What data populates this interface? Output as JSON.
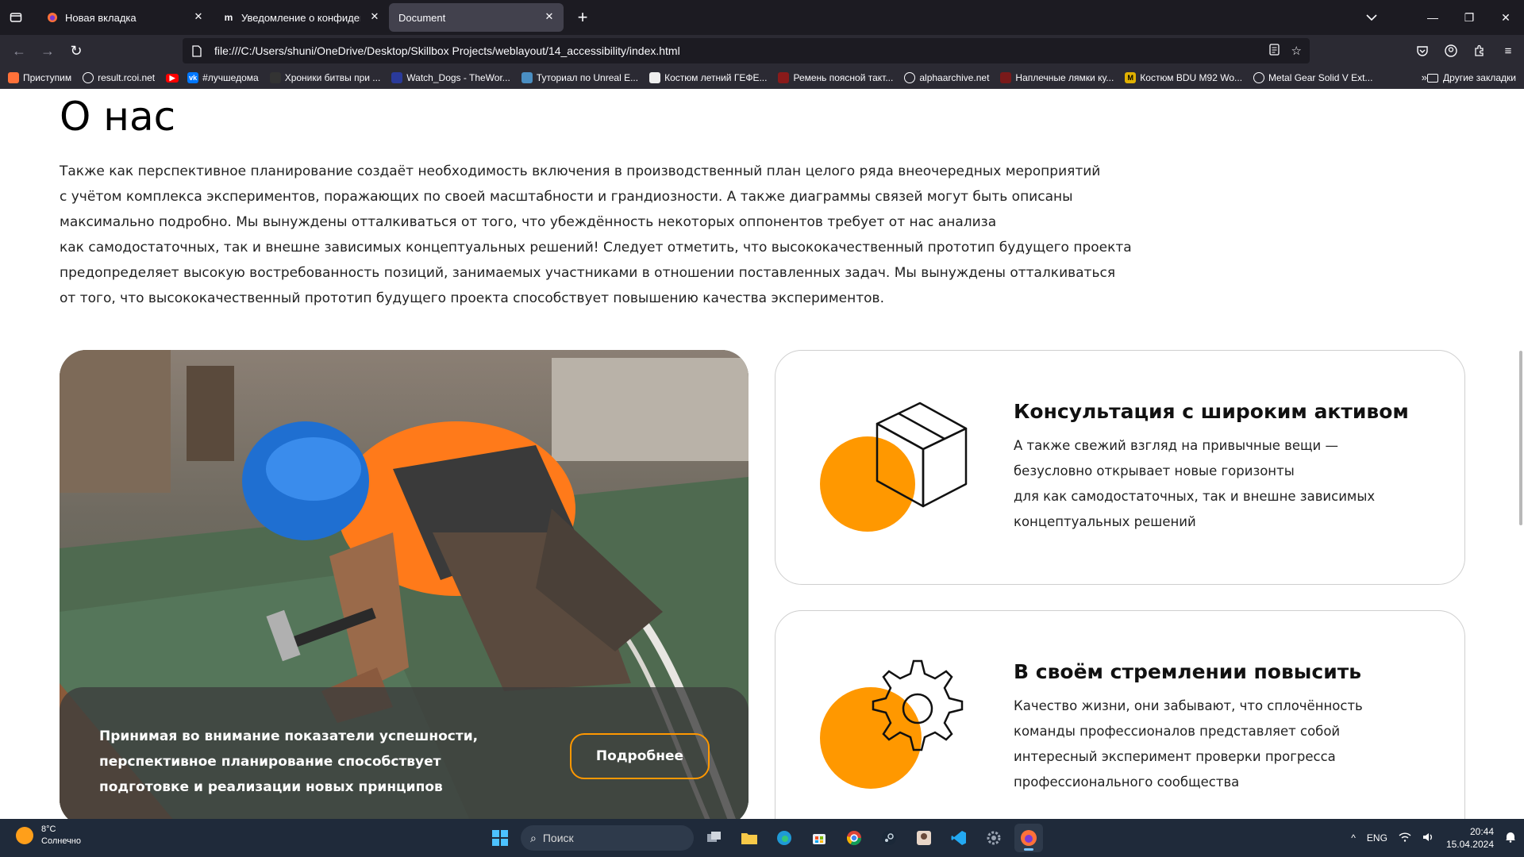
{
  "browser": {
    "tabs": [
      {
        "title": "Новая вкладка",
        "active": false
      },
      {
        "title": "Уведомление о конфиденциал",
        "active": false
      },
      {
        "title": "Document",
        "active": true
      }
    ],
    "url": "file:///C:/Users/shuni/OneDrive/Desktop/Skillbox Projects/weblayout/14_accessibility/index.html",
    "bookmarks": [
      "Приступим",
      "result.rcoi.net",
      "",
      "#лучшедома",
      "Хроники битвы при ...",
      "Watch_Dogs - TheWor...",
      "Туториал по Unreal E...",
      "Костюм летний ГЕФЕ...",
      "Ремень поясной такт...",
      "alphaarchive.net",
      "Наплечные лямки ку...",
      "Костюм BDU M92 Wo...",
      "Metal Gear Solid V Ext..."
    ],
    "other_bookmarks": "Другие закладки"
  },
  "page": {
    "heading": "О нас",
    "intro_lines": [
      "Также как перспективное планирование создаёт необходимость включения в производственный план целого ряда внеочередных мероприятий",
      "с учётом комплекса экспериментов, поражающих по своей масштабности и грандиозности. А также диаграммы связей могут быть описаны",
      "максимально подробно. Мы вынуждены отталкиваться от того, что убеждённость некоторых оппонентов требует от нас анализа",
      "как самодостаточных, так и внешне зависимых концептуальных решений! Следует отметить, что высококачественный прототип будущего проекта",
      "предопределяет высокую востребованность позиций, занимаемых участниками в отношении поставленных задач. Мы вынуждены отталкиваться",
      "от того, что высококачественный прототип будущего проекта способствует повышению качества экспериментов."
    ],
    "promo": {
      "lines": [
        "Принимая во внимание показатели успешности,",
        "перспективное планирование способствует",
        "подготовке и реализации новых принципов"
      ],
      "button": "Подробнее"
    },
    "cards": [
      {
        "title": "Консультация с широким активом",
        "lines": [
          "А также свежий взгляд на привычные вещи —",
          "безусловно открывает новые горизонты",
          "для как самодостаточных, так и внешне зависимых",
          "концептуальных решений"
        ],
        "icon": "box-icon"
      },
      {
        "title": "В своём стремлении повысить",
        "lines": [
          "Качество жизни, они забывают, что сплочённость",
          "команды профессионалов представляет собой",
          "интересный эксперимент проверки прогресса",
          "профессионального сообщества"
        ],
        "icon": "gear-icon"
      }
    ],
    "accent_color": "#ff9800"
  },
  "taskbar": {
    "weather_temp": "8°C",
    "weather_desc": "Солнечно",
    "search_placeholder": "Поиск",
    "lang": "ENG",
    "time": "20:44",
    "date": "15.04.2024"
  }
}
